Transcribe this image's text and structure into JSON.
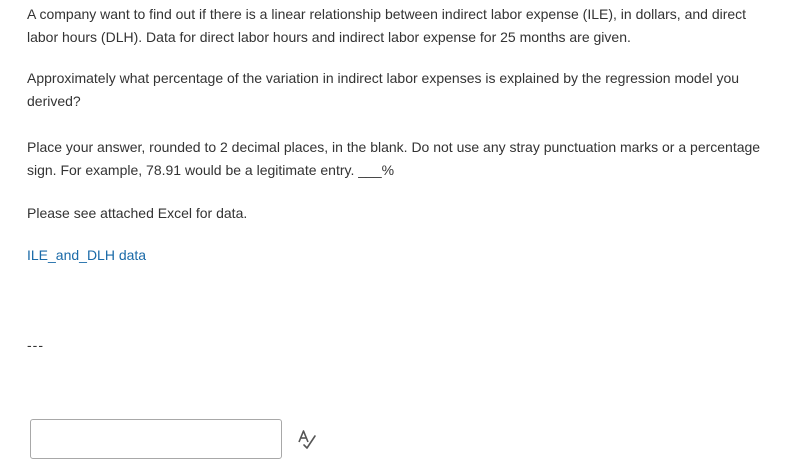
{
  "question": {
    "paragraph1": "A company want to find out if there is a linear relationship between indirect labor expense (ILE), in dollars, and direct labor hours (DLH). Data for direct labor hours and indirect labor expense for 25 months are given.",
    "paragraph2": "Approximately what percentage of the variation in indirect labor expenses is explained by the regression model you derived?",
    "paragraph3": "Place your answer, rounded to 2 decimal places, in the blank. Do not use any stray punctuation marks or a percentage sign. For example, 78.91 would be a legitimate entry. ___%",
    "paragraph4": "Please see attached Excel for data.",
    "attachment_link": "ILE_and_DLH data",
    "separator": "---"
  },
  "answer": {
    "value": "",
    "placeholder": ""
  },
  "icons": {
    "spellcheck": "spellcheck-icon"
  },
  "colors": {
    "text": "#333333",
    "link": "#1a6aa8",
    "input_border": "#a8a8a8"
  }
}
